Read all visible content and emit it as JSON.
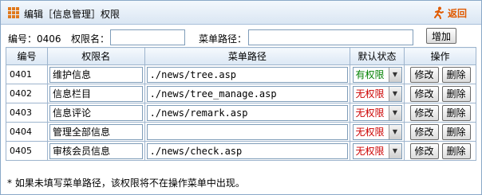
{
  "title": "编辑［信息管理］权限",
  "back_label": "返回",
  "form": {
    "code_label": "编号：0406",
    "name_label": "权限名：",
    "name_value": "",
    "path_label": "菜单路径：",
    "path_value": "",
    "add_button": "增加"
  },
  "table": {
    "headers": [
      "编号",
      "权限名",
      "菜单路径",
      "默认状态",
      "操作"
    ],
    "rows": [
      {
        "id": "0401",
        "name": "维护信息",
        "path": "./news/tree.asp",
        "state": "有权限",
        "state_color": "#008000"
      },
      {
        "id": "0402",
        "name": "信息栏目",
        "path": "./news/tree_manage.asp",
        "state": "无权限",
        "state_color": "#cc0000"
      },
      {
        "id": "0403",
        "name": "信息评论",
        "path": "./news/remark.asp",
        "state": "无权限",
        "state_color": "#cc0000"
      },
      {
        "id": "0404",
        "name": "管理全部信息",
        "path": "",
        "state": "无权限",
        "state_color": "#cc0000"
      },
      {
        "id": "0405",
        "name": "审核会员信息",
        "path": "./news/check.asp",
        "state": "无权限",
        "state_color": "#cc0000"
      }
    ],
    "edit_label": "修改",
    "delete_label": "删除"
  },
  "note": "* 如果未填写菜单路径，该权限将不在操作菜单中出现。",
  "colors": {
    "accent": "#e05a00",
    "header_bg": "#dbe7f4",
    "border": "#9db4cd"
  }
}
